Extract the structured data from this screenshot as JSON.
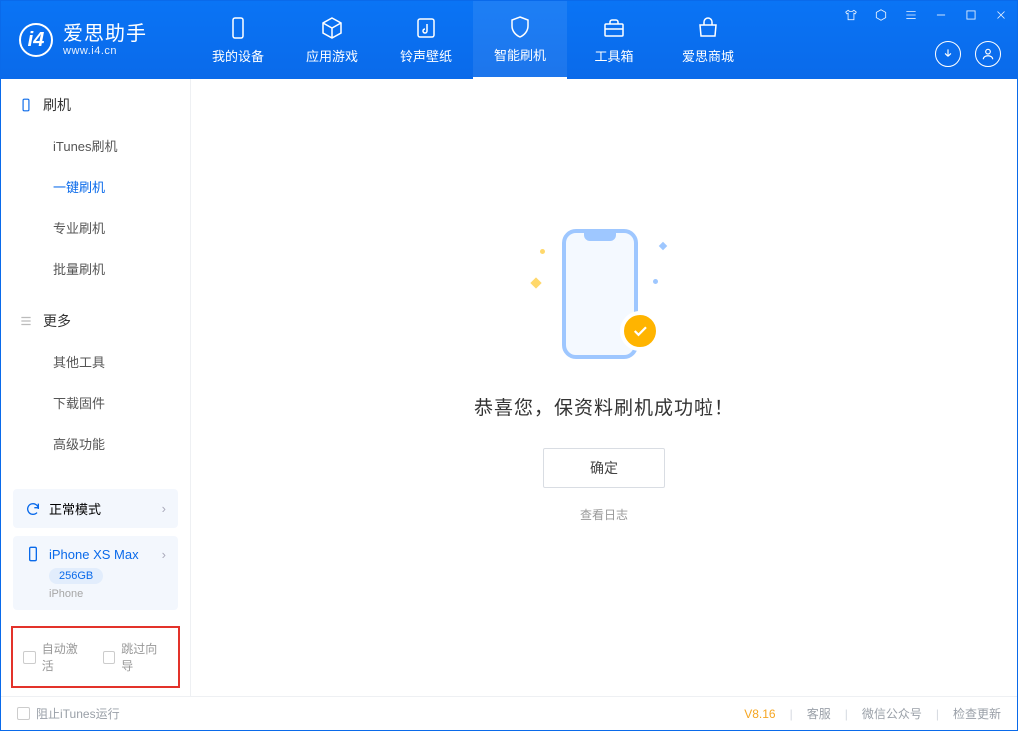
{
  "logo": {
    "main": "爱思助手",
    "sub": "www.i4.cn"
  },
  "tabs": {
    "device": "我的设备",
    "apps": "应用游戏",
    "ring": "铃声壁纸",
    "flash": "智能刷机",
    "tools": "工具箱",
    "store": "爱思商城"
  },
  "sidebar": {
    "flash_title": "刷机",
    "more_title": "更多",
    "items": {
      "itunes": "iTunes刷机",
      "onekey": "一键刷机",
      "pro": "专业刷机",
      "batch": "批量刷机",
      "other_tools": "其他工具",
      "download_fw": "下载固件",
      "advanced": "高级功能"
    }
  },
  "device": {
    "mode": "正常模式",
    "name": "iPhone XS Max",
    "capacity": "256GB",
    "type": "iPhone"
  },
  "bottom_options": {
    "auto_activate": "自动激活",
    "skip_guide": "跳过向导"
  },
  "main": {
    "success": "恭喜您，保资料刷机成功啦！",
    "ok": "确定",
    "view_log": "查看日志"
  },
  "statusbar": {
    "block_itunes": "阻止iTunes运行",
    "version": "V8.16",
    "service": "客服",
    "wechat": "微信公众号",
    "update": "检查更新"
  }
}
